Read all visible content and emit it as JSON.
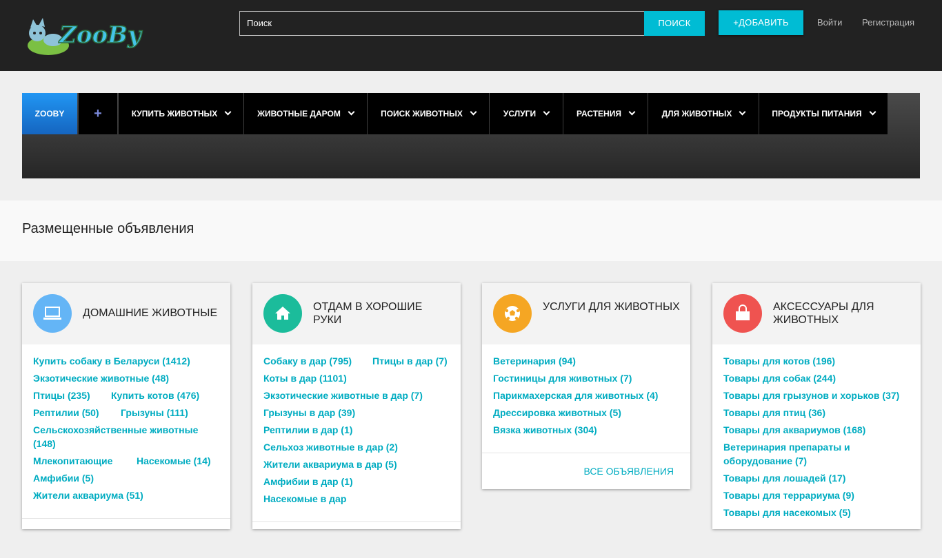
{
  "header": {
    "logo_text": "ZooBy",
    "search_placeholder": "Поиск",
    "search_button": "ПОИСК",
    "add_button": "+ДОБАВИТЬ",
    "login": "Войти",
    "register": "Регистрация"
  },
  "nav": {
    "brand": "ZOOBY",
    "plus": "+",
    "items": [
      {
        "label": "КУПИТЬ ЖИВОТНЫХ"
      },
      {
        "label": "ЖИВОТНЫЕ ДАРОМ"
      },
      {
        "label": "ПОИСК ЖИВОТНЫХ"
      },
      {
        "label": "УСЛУГИ"
      },
      {
        "label": "РАСТЕНИЯ"
      },
      {
        "label": "ДЛЯ ЖИВОТНЫХ"
      },
      {
        "label": "ПРОДУКТЫ ПИТАНИЯ"
      }
    ]
  },
  "banner": {
    "title": "Размещенные объявления"
  },
  "cards": [
    {
      "title": "ДОМАШНИЕ ЖИВОТНЫЕ",
      "icon": "laptop-icon",
      "icon_color": "#64b5f6",
      "links": [
        "Купить собаку в Беларуси (1412)",
        "Экзотические животные (48)",
        "Птицы (235)",
        "Купить котов (476)",
        "Рептилии (50)",
        "Грызуны (111)",
        "Сельскохозяйственные животные (148)",
        "Млекопитающие",
        "Насекомые (14)",
        "Амфибии (5)",
        "Жители аквариума (51)"
      ]
    },
    {
      "title": "ОТДАМ В ХОРОШИЕ РУКИ",
      "icon": "home-icon",
      "icon_color": "#1bbc9b",
      "links": [
        "Собаку в дар (795)",
        "Птицы в дар (7)",
        "Коты в дар (1101)",
        "Экзотические животные в дар (7)",
        "Грызуны в дар (39)",
        "Рептилии в дар (1)",
        "Сельхоз животные в дар (2)",
        "Жители аквариума в дар (5)",
        "Амфибии в дар (1)",
        "Насекомые в дар"
      ]
    },
    {
      "title": "УСЛУГИ ДЛЯ ЖИВОТНЫХ",
      "icon": "soccer-ball-icon",
      "icon_color": "#f5a623",
      "links": [
        "Ветеринария (94)",
        "Гостиницы для животных (7)",
        "Парикмахерская для животных (4)",
        "Дрессировка животных (5)",
        "Вязка животных (304)"
      ],
      "all_link": "ВСЕ ОБЪЯВЛЕНИЯ"
    },
    {
      "title": "АКСЕССУАРЫ ДЛЯ ЖИВОТНЫХ",
      "icon": "shopping-bag-icon",
      "icon_color": "#ef5350",
      "links": [
        "Товары для котов (196)",
        "Товары для собак (244)",
        "Товары для грызунов и хорьков (37)",
        "Товары для птиц (36)",
        "Товары для аквариумов (168)",
        "Ветеринария препараты и оборудование (7)",
        "Товары для лошадей (17)",
        "Товары для террариума (9)",
        "Товары для насекомых (5)"
      ]
    }
  ]
}
